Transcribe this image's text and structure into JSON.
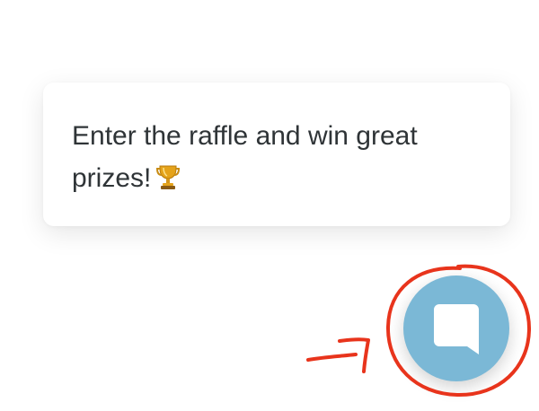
{
  "popup": {
    "message": "Enter the raffle and win great prizes!",
    "emoji_icon": "trophy-icon"
  },
  "launcher": {
    "icon": "chat-bubble-icon",
    "background_color": "#7bb8d6"
  },
  "annotation": {
    "circle_color": "#e8341c",
    "arrow_color": "#e8341c"
  }
}
